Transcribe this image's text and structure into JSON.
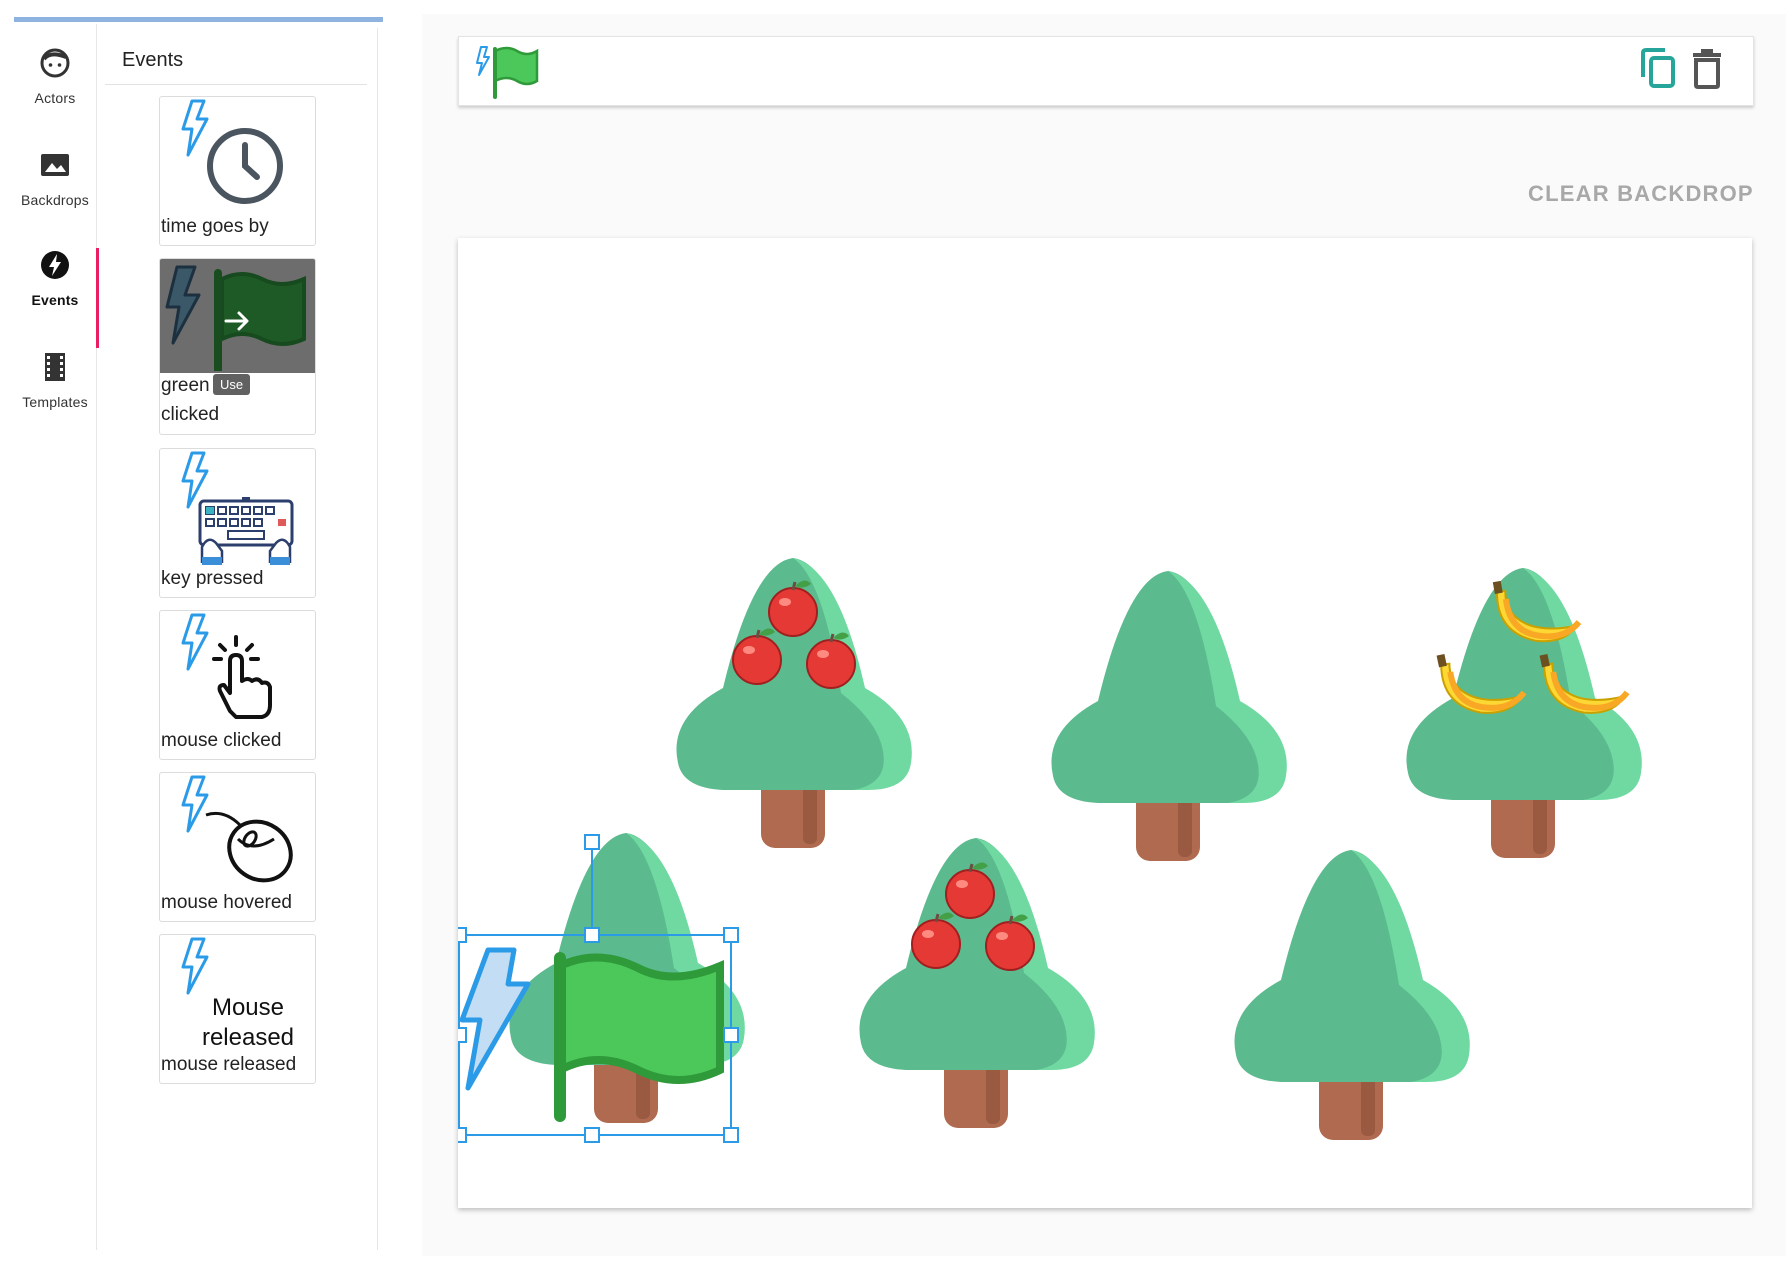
{
  "nav": {
    "items": [
      {
        "label": "Actors",
        "icon": "actor-face-icon"
      },
      {
        "label": "Backdrops",
        "icon": "image-icon"
      },
      {
        "label": "Events",
        "icon": "lightning-circle-icon"
      },
      {
        "label": "Templates",
        "icon": "film-strip-icon"
      }
    ],
    "active": "Events"
  },
  "panel": {
    "title": "Events",
    "cards": [
      {
        "caption": "time goes by",
        "icon": "clock-icon"
      },
      {
        "caption_line1": "green",
        "caption_line2": "clicked",
        "icon": "green-flag-icon",
        "tooltip": "Use"
      },
      {
        "caption": "key pressed",
        "icon": "keyboard-icon"
      },
      {
        "caption": "mouse clicked",
        "icon": "hand-pointer-icon"
      },
      {
        "caption": "mouse hovered",
        "icon": "mouse-icon"
      },
      {
        "caption": "mouse released",
        "icon_text_line1": "Mouse",
        "icon_text_line2": "released"
      }
    ]
  },
  "toolbar": {
    "event_icon": "lightning-flag-icon",
    "copy_icon": "copy-icon",
    "delete_icon": "trash-icon"
  },
  "stage": {
    "clear_backdrop_label": "CLEAR BACKDROP",
    "selected_actor": "green flag event",
    "trees": [
      {
        "fruit": "apple"
      },
      {
        "fruit": "none"
      },
      {
        "fruit": "banana"
      },
      {
        "fruit": "none"
      },
      {
        "fruit": "apple"
      },
      {
        "fruit": "none"
      }
    ]
  },
  "colors": {
    "accent": "#e91e63",
    "bolt": "#2b9be8",
    "flag": "#4cc85a",
    "tree": "#5bba8e",
    "trunk": "#b06a4f",
    "copy_icon": "#26a69a"
  }
}
